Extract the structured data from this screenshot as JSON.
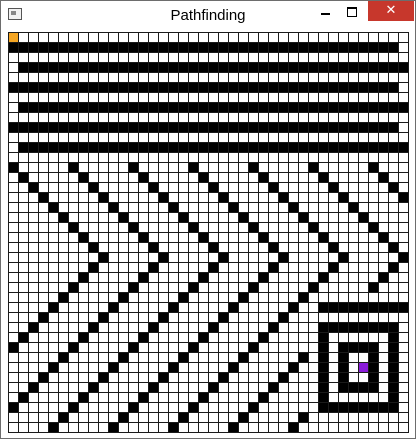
{
  "window": {
    "title": "Pathfinding",
    "icon": "app-window-icon",
    "controls": {
      "minimize": "minimize-icon",
      "maximize": "maximize-icon",
      "close": "✕"
    },
    "close_color": "#c7372c"
  },
  "grid": {
    "cols": 40,
    "rows": 40,
    "colors": {
      "empty": "#ffffff",
      "wall": "#000000",
      "line": "#1a1a1a",
      "start": "#f5a623",
      "goal": "#8a1bd9"
    },
    "start": {
      "col": 0,
      "row": 0
    },
    "goal": {
      "col": 35,
      "row": 33
    }
  }
}
